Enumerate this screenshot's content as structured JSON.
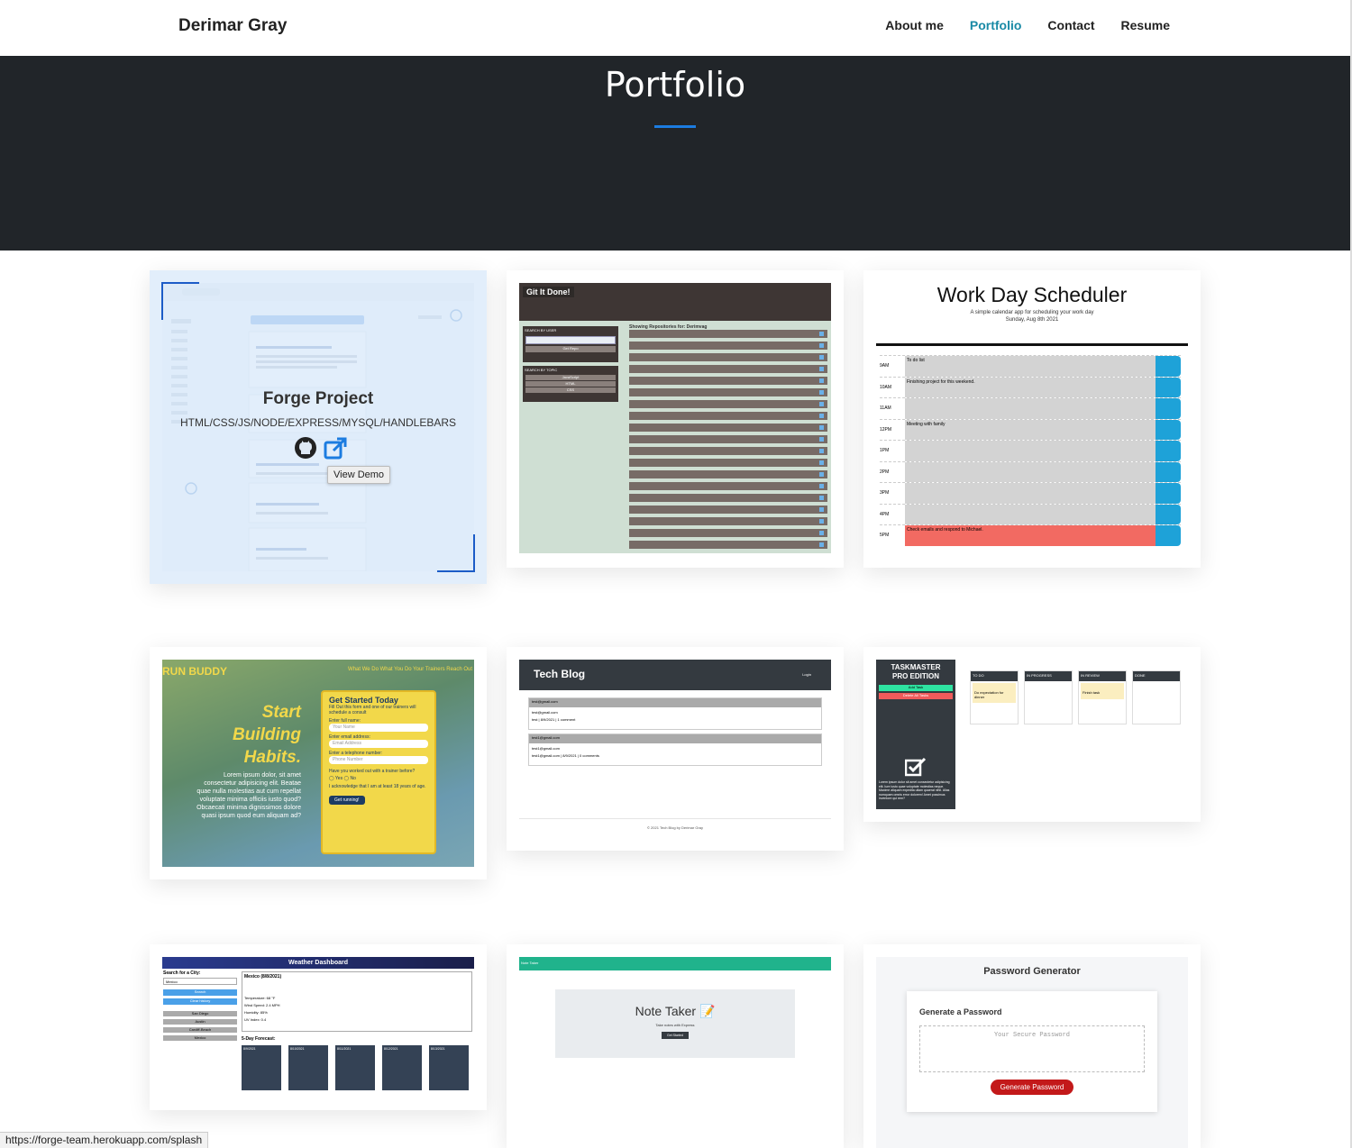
{
  "nav": {
    "brand": "Derimar Gray",
    "links": [
      {
        "label": "About me",
        "active": false
      },
      {
        "label": "Portfolio",
        "active": true
      },
      {
        "label": "Contact",
        "active": false
      },
      {
        "label": "Resume",
        "active": false
      }
    ]
  },
  "hero": {
    "title": "Portfolio"
  },
  "projects": [
    {
      "title": "Forge Project",
      "tech": "HTML/CSS/JS/NODE/EXPRESS/MYSQL/HANDLEBARS",
      "tooltip": "View Demo",
      "hovered": true
    },
    {
      "thumb_title": "Git It Done!",
      "thumb_subtitle": "Showing Repositories for: Derimvag",
      "sidebar_labels": [
        "SEARCH BY USER",
        "SEARCH BY TOPIC"
      ],
      "button_label": "Get Repo",
      "topics": [
        "JavaScript",
        "HTML",
        "CSS"
      ]
    },
    {
      "thumb_title": "Work Day Scheduler",
      "thumb_subtitle": "A simple calendar app for scheduling your work day",
      "thumb_date": "Sunday, Aug 8th 2021",
      "hours": [
        "9AM",
        "10AM",
        "11AM",
        "12PM",
        "1PM",
        "2PM",
        "3PM",
        "4PM",
        "5PM"
      ],
      "entries": [
        "To do list",
        "Finishing project for this weekend.",
        "",
        "Meeting with family",
        "",
        "",
        "",
        "",
        "Check emails and respond to Michael."
      ]
    },
    {
      "thumb_title": "RUN BUDDY",
      "thumb_nav": "What We Do  What You Do  Your Trainers  Reach Out",
      "headline": [
        "Start",
        "Building",
        "Habits."
      ],
      "body": "Lorem ipsum dolor, sit amet consectetur adipisicing elit. Beatae quae nulla molestias aut cum repellat voluptate minima officiis iusto quod? Obcaecati minima dignissimos dolore quasi ipsum quod eum aliquam ad?",
      "form_title": "Get Started Today",
      "form_intro": "Fill Out this form and one of our trainers will schedule a consult",
      "fields": [
        "Enter full name:",
        "Enter email address:",
        "Enter a telephone number:"
      ],
      "placeholders": [
        "Your Name",
        "Email Address",
        "Phone Number"
      ],
      "question": "Have you worked out with a trainer before?",
      "options": [
        "Yes",
        "No"
      ],
      "ack": "I acknowledge that I am at least 18 years of age.",
      "cta": "Get running!"
    },
    {
      "thumb_title": "Tech Blog",
      "login": "Login",
      "posts": [
        {
          "header": "test@gmail.com",
          "body": "test@gmail.com",
          "meta": "test | 8/9/2021 | 1 comment"
        },
        {
          "header": "test1@gmail.com",
          "body": "test1@gmail.com",
          "meta": "test1@gmail.com | 8/9/2021 | 0 comments"
        }
      ],
      "footer": "© 2021 Tech Blog by Derimar Gray"
    },
    {
      "thumb_title": "TASKMASTER PRO EDITION",
      "buttons": [
        "Add Task",
        "Delete All Tasks"
      ],
      "columns": [
        "TO DO",
        "IN PROGRESS",
        "IN REVIEW",
        "DONE"
      ],
      "tasks": {
        "todo": "Do expectation for dinner",
        "review": "Finish task"
      },
      "blurb": "Lorem ipsum dolor sit amet consectetur adipisicing elit. Iure iusto quae voluptate molestias neque. Maxime aliquam expedita ullam quaerat nihil. Alias numquam omnis error dolorem! Amet possimus inventore qui rem?"
    },
    {
      "thumb_title": "Weather Dashboard",
      "search_label": "Search for a City:",
      "search_value": "Mexico",
      "buttons": [
        "Search",
        "Clear history"
      ],
      "history": [
        "San Diego",
        "Austin",
        "Cardiff-Beach",
        "Mexico"
      ],
      "city": "Mexico (8/8/2021)",
      "stats": [
        "Temperature: 68 °F",
        "Wind Speed: 2.4 MPH",
        "Humidity: 85%",
        "UV Index: 0.4"
      ],
      "forecast_label": "5-Day Forecast:",
      "forecast_dates": [
        "8/9/2021",
        "8/10/2021",
        "8/11/2021",
        "8/12/2021",
        "8/13/2021"
      ]
    },
    {
      "thumb_nav": "Note Taker",
      "thumb_title": "Note Taker 📝",
      "thumb_subtitle": "Take notes with Express",
      "button": "Get Started"
    },
    {
      "thumb_title": "Password Generator",
      "card_title": "Generate a Password",
      "placeholder": "Your Secure Password",
      "button": "Generate Password"
    }
  ],
  "status_url": "https://forge-team.herokuapp.com/splash",
  "colors": {
    "accent": "#1a8aa6",
    "hero_bg": "#212529",
    "hero_rule": "#1c7ce0"
  }
}
